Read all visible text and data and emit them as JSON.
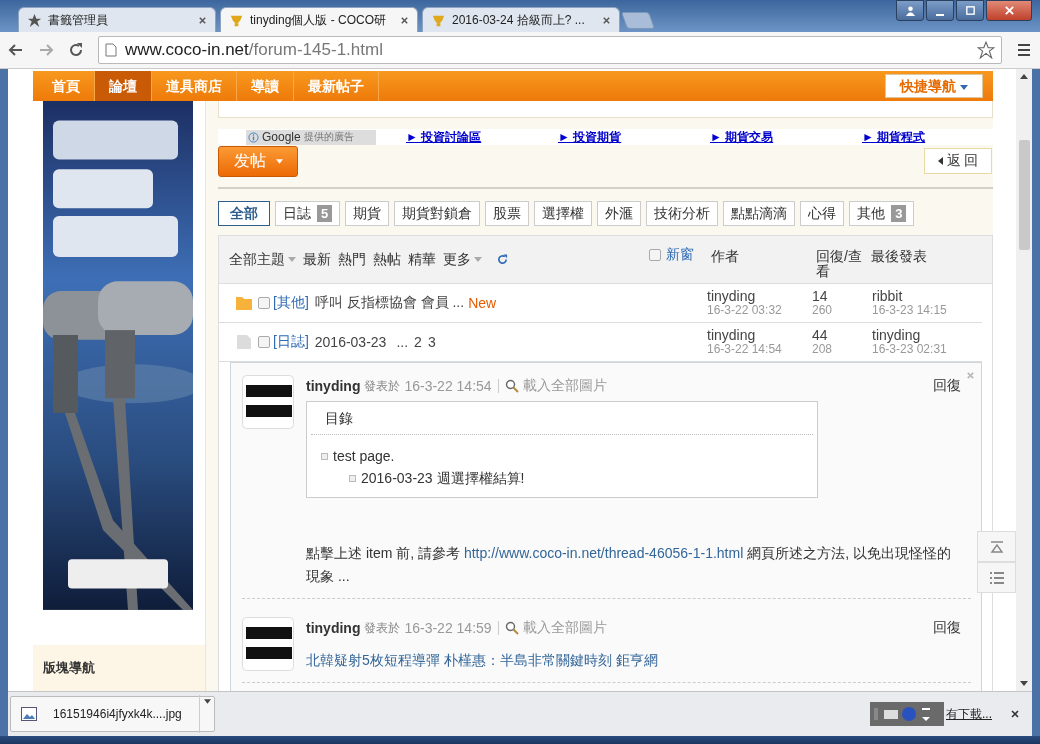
{
  "browser": {
    "tabs": [
      {
        "title": "書籤管理員",
        "selected": false
      },
      {
        "title": "tinyding個人版 - COCO研",
        "selected": true
      },
      {
        "title": "2016-03-24 拾級而上? ...",
        "selected": false
      }
    ],
    "url_host": "www.coco-in.net",
    "url_path": "/forum-145-1.html"
  },
  "nav": {
    "items": [
      {
        "label": "首頁",
        "selected": false
      },
      {
        "label": "論壇",
        "selected": true
      },
      {
        "label": "道具商店",
        "selected": false
      },
      {
        "label": "導讀",
        "selected": false
      },
      {
        "label": "最新帖子",
        "selected": false
      }
    ],
    "quick": "快捷導航"
  },
  "sidebar": {
    "heading": "版塊導航"
  },
  "ads": {
    "badge": "Google",
    "badge_note": "提供的廣告",
    "links": [
      "► 投資討論區",
      "► 投資期貨",
      "► 期貨交易",
      "► 期貨程式"
    ]
  },
  "post_button": "发帖",
  "back_button": "返 回",
  "filters": [
    {
      "label": "全部",
      "selected": true
    },
    {
      "label": "日誌",
      "count": "5",
      "selected": false
    },
    {
      "label": "期貨",
      "selected": false
    },
    {
      "label": "期貨對鎖倉",
      "selected": false
    },
    {
      "label": "股票",
      "selected": false
    },
    {
      "label": "選擇權",
      "selected": false
    },
    {
      "label": "外滙",
      "selected": false
    },
    {
      "label": "技術分析",
      "selected": false
    },
    {
      "label": "點點滴滴",
      "selected": false
    },
    {
      "label": "心得",
      "selected": false
    },
    {
      "label": "其他",
      "count": "3",
      "selected": false
    }
  ],
  "thread_header": {
    "sorts": [
      {
        "label": "全部主題",
        "dropdown": true
      },
      {
        "label": "最新",
        "dropdown": false
      },
      {
        "label": "熱門",
        "dropdown": false
      },
      {
        "label": "熱帖",
        "dropdown": false
      },
      {
        "label": "精華",
        "dropdown": false
      },
      {
        "label": "更多",
        "dropdown": true
      }
    ],
    "new_window": {
      "label": "新窗",
      "checked": false
    },
    "author": "作者",
    "replies": "回復/查看",
    "last": "最後發表"
  },
  "threads": [
    {
      "unread": true,
      "checked": false,
      "category": "[其他]",
      "title": "呼叫 反指標協會 會員 ...",
      "new_badge": "New",
      "author": "tinyding",
      "date": "16-3-22 03:32",
      "replies": "14",
      "views": "260",
      "last_user": "ribbit",
      "last_date": "16-3-23 14:15"
    },
    {
      "unread": false,
      "checked": false,
      "category": "[日誌]",
      "title": "2016-03-23",
      "pages_prefix": "...",
      "pages": [
        "2",
        "3"
      ],
      "author": "tinyding",
      "date": "16-3-22 14:54",
      "replies": "44",
      "views": "208",
      "last_user": "tinyding",
      "last_date": "16-3-23 02:31"
    }
  ],
  "posts": [
    {
      "author": "tinyding",
      "posted_label": "發表於",
      "time": "16-3-22 14:54",
      "load_images": "載入全部圖片",
      "reply": "回復",
      "toc": {
        "title": "目錄",
        "items": [
          {
            "text": "test page.",
            "children": [
              {
                "text": "2016-03-23 週選擇權結算!"
              }
            ]
          }
        ]
      },
      "body": [
        {
          "kind": "text",
          "text": "點擊上述 item 前, 請參考 "
        },
        {
          "kind": "link",
          "text": "http://www.coco-in.net/thread-46056-1-1.html"
        },
        {
          "kind": "text",
          "text": " 網頁所述之方法, 以免出現怪怪的現象 ..."
        }
      ]
    },
    {
      "author": "tinyding",
      "posted_label": "發表於",
      "time": "16-3-22 14:59",
      "load_images": "載入全部圖片",
      "reply": "回復",
      "body": [
        {
          "kind": "link",
          "text": "北韓疑射5枚短程導彈 朴槿惠：半島非常關鍵時刻  鉅亨網"
        }
      ]
    }
  ],
  "download": {
    "file": "16151946i4jfyxk4k....jpg",
    "show_all": "有下載..."
  }
}
